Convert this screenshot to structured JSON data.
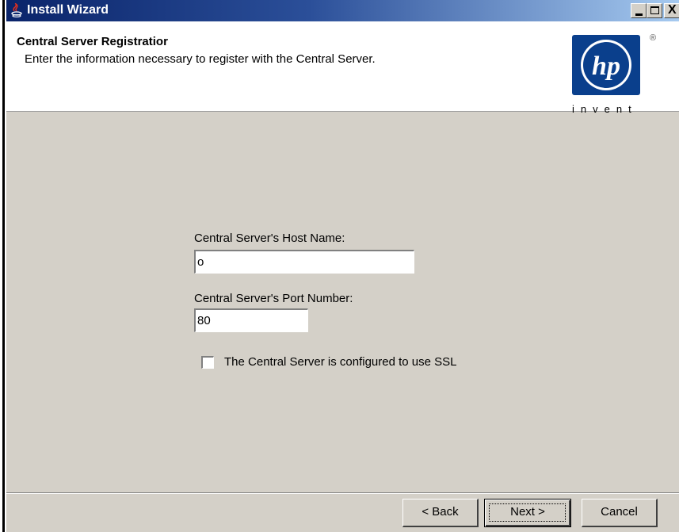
{
  "window": {
    "title": "Install Wizard",
    "minimize_icon": "minimize-icon",
    "maximize_icon": "maximize-icon",
    "close_glyph": "X"
  },
  "header": {
    "title": "Central Server Registratior",
    "description": "Enter the information necessary to register with the Central Server.",
    "logo": {
      "text": "hp",
      "tagline": "invent",
      "registered_mark": "®",
      "brand_color": "#0a3f8c"
    }
  },
  "form": {
    "host_label": "Central Server's Host Name:",
    "host_value": "o",
    "port_label": "Central Server's Port Number:",
    "port_value": "80",
    "ssl_label": "The Central Server is configured to use SSL",
    "ssl_checked": false
  },
  "buttons": {
    "back": "< Back",
    "next": "Next >",
    "cancel": "Cancel"
  },
  "colors": {
    "titlebar_start": "#0a246a",
    "titlebar_end": "#a6caf0",
    "dialog_bg": "#d4d0c8"
  }
}
